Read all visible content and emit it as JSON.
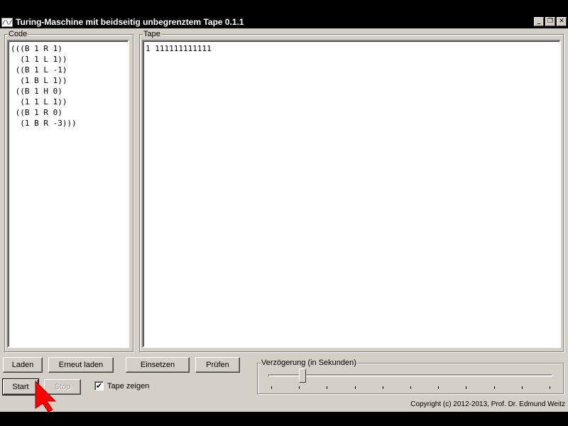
{
  "window": {
    "title": "Turing-Maschine mit beidseitig unbegrenztem Tape 0.1.1",
    "icon_text": "/\\/\\",
    "buttons": {
      "minimize": "_",
      "restore": "❐",
      "close": "✕"
    }
  },
  "code_panel": {
    "label": "Code",
    "lines": [
      "(((B 1 R 1)",
      "  (1 1 L 1))",
      " ((B 1 L -1)",
      "  (1 B L 1))",
      " ((B 1 H 0)",
      "  (1 1 L 1))",
      " ((B 1 R 0)",
      "  (1 B R -3)))"
    ]
  },
  "tape_panel": {
    "label": "Tape",
    "content": "1 111111111111"
  },
  "buttons": {
    "load": "Laden",
    "reload": "Erneut laden",
    "insert": "Einsetzen",
    "check": "Prüfen",
    "start": "Start",
    "stop": "Stop"
  },
  "show_tape": {
    "label": "Tape zeigen",
    "checked": true,
    "mark": "✔"
  },
  "delay": {
    "label": "Verzögerung (in Sekunden)",
    "level": 0.12,
    "tick_count": 11
  },
  "status": {
    "copyright": "Copyright (c) 2012-2013, Prof. Dr. Edmund Weitz"
  },
  "colors": {
    "face": "#d4d0c8",
    "titlebar": "#000000",
    "cursor": "#ff0000"
  }
}
